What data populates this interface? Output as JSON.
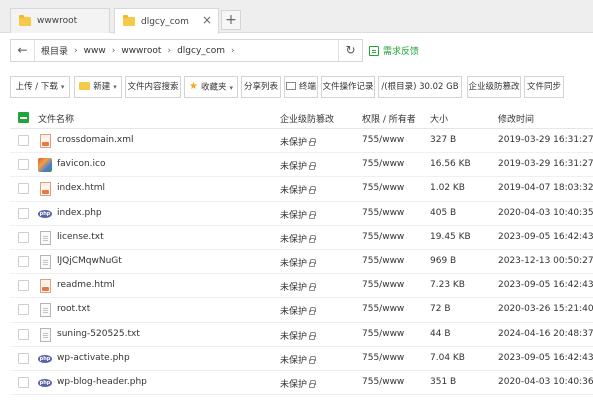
{
  "tabs": [
    {
      "label": "wwwroot",
      "active": false
    },
    {
      "label": "dlgcy_com",
      "active": true
    }
  ],
  "address": {
    "crumbs": [
      "根目录",
      "www",
      "wwwroot",
      "dlgcy_com"
    ],
    "feedback": "需求反馈"
  },
  "toolbar": {
    "upload_download": "上传 / 下载",
    "new": "新建",
    "search_content": "文件内容搜索",
    "favorites": "收藏夹",
    "share_list": "分享列表",
    "terminal": "终端",
    "op_log": "文件操作记录",
    "disk": "/(根目录) 30.02 GB",
    "protection": "企业级防篡改",
    "sync": "文件同步"
  },
  "table": {
    "columns": {
      "name": "文件名称",
      "protection": "企业级防篡改",
      "perm": "权限 / 所有者",
      "size": "大小",
      "mtime": "修改时间"
    },
    "rows": [
      {
        "name": "crossdomain.xml",
        "icon": "xml-file-icon",
        "protection": "未保护",
        "perm": "755/www",
        "size": "327 B",
        "mtime": "2019-03-29 16:31:27"
      },
      {
        "name": "favicon.ico",
        "icon": "image-file-icon",
        "protection": "未保护",
        "perm": "755/www",
        "size": "16.56 KB",
        "mtime": "2019-03-29 16:31:27"
      },
      {
        "name": "index.html",
        "icon": "html-file-icon",
        "protection": "未保护",
        "perm": "755/www",
        "size": "1.02 KB",
        "mtime": "2019-04-07 18:03:32"
      },
      {
        "name": "index.php",
        "icon": "php-file-icon",
        "protection": "未保护",
        "perm": "755/www",
        "size": "405 B",
        "mtime": "2020-04-03 10:40:35"
      },
      {
        "name": "license.txt",
        "icon": "text-file-icon",
        "protection": "未保护",
        "perm": "755/www",
        "size": "19.45 KB",
        "mtime": "2023-09-05 16:42:43"
      },
      {
        "name": "lJQjCMqwNuGt",
        "icon": "text-file-icon",
        "protection": "未保护",
        "perm": "755/www",
        "size": "969 B",
        "mtime": "2023-12-13 00:50:27"
      },
      {
        "name": "readme.html",
        "icon": "html-file-icon",
        "protection": "未保护",
        "perm": "755/www",
        "size": "7.23 KB",
        "mtime": "2023-09-05 16:42:43"
      },
      {
        "name": "root.txt",
        "icon": "text-file-icon",
        "protection": "未保护",
        "perm": "755/www",
        "size": "72 B",
        "mtime": "2020-03-26 15:21:40"
      },
      {
        "name": "suning-520525.txt",
        "icon": "text-file-icon",
        "protection": "未保护",
        "perm": "755/www",
        "size": "44 B",
        "mtime": "2024-04-16 20:48:37"
      },
      {
        "name": "wp-activate.php",
        "icon": "php-file-icon",
        "protection": "未保护",
        "perm": "755/www",
        "size": "7.04 KB",
        "mtime": "2023-09-05 16:42:43"
      },
      {
        "name": "wp-blog-header.php",
        "icon": "php-file-icon",
        "protection": "未保护",
        "perm": "755/www",
        "size": "351 B",
        "mtime": "2020-04-03 10:40:36"
      }
    ]
  },
  "colors": {
    "accent": "#20a53a",
    "folder": "#f7c948",
    "php": "#5b63a8"
  }
}
